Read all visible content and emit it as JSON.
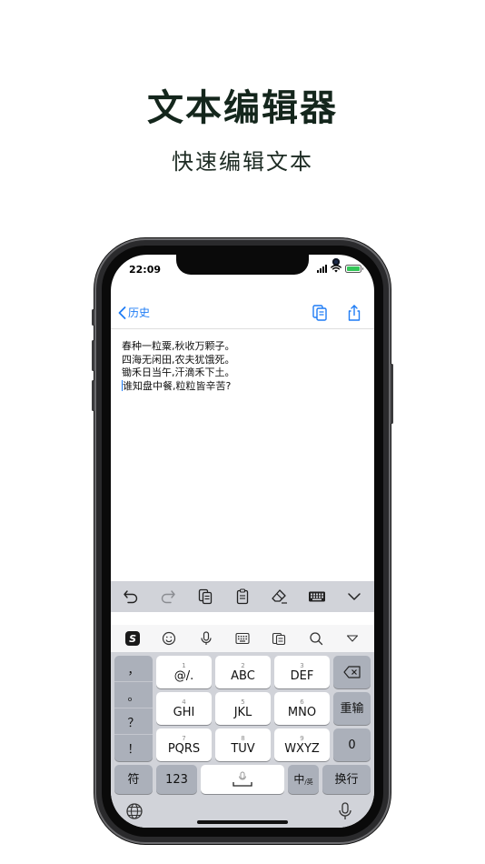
{
  "hero": {
    "title": "文本编辑器",
    "subtitle": "快速编辑文本"
  },
  "status_bar": {
    "time": "22:09"
  },
  "navbar": {
    "back_label": "历史",
    "icons": [
      "copy-document-icon",
      "share-icon"
    ]
  },
  "editor": {
    "lines": [
      "春种一粒粟,秋收万颗子。",
      "四海无闲田,农夫犹饿死。",
      "锄禾日当午,汗滴禾下土。",
      "谁知盘中餐,粒粒皆辛苦?"
    ]
  },
  "toolbar": {
    "icons": [
      "undo-icon",
      "redo-icon",
      "copy-icon",
      "paste-icon",
      "clear-icon",
      "keyboard-icon",
      "dismiss-keyboard-icon"
    ]
  },
  "ime_bar": {
    "logo": "S",
    "icons": [
      "emoji-icon",
      "microphone-icon",
      "keyboard-layout-icon",
      "clipboard-icon",
      "search-icon",
      "collapse-icon"
    ]
  },
  "keyboard": {
    "punctuation": [
      "，",
      "。",
      "？",
      "！"
    ],
    "keys": [
      {
        "num": "1",
        "label": "@/."
      },
      {
        "num": "2",
        "label": "ABC"
      },
      {
        "num": "3",
        "label": "DEF"
      },
      {
        "num": "4",
        "label": "GHI"
      },
      {
        "num": "5",
        "label": "JKL"
      },
      {
        "num": "6",
        "label": "MNO"
      },
      {
        "num": "7",
        "label": "PQRS"
      },
      {
        "num": "8",
        "label": "TUV"
      },
      {
        "num": "9",
        "label": "WXYZ"
      }
    ],
    "retype": "重输",
    "zero": "0",
    "symbols": "符",
    "numbers": "123",
    "lang": "中",
    "lang_sub": "/英",
    "return": "换行"
  },
  "colors": {
    "accent": "#1e7cf5",
    "battery": "#34c759"
  }
}
